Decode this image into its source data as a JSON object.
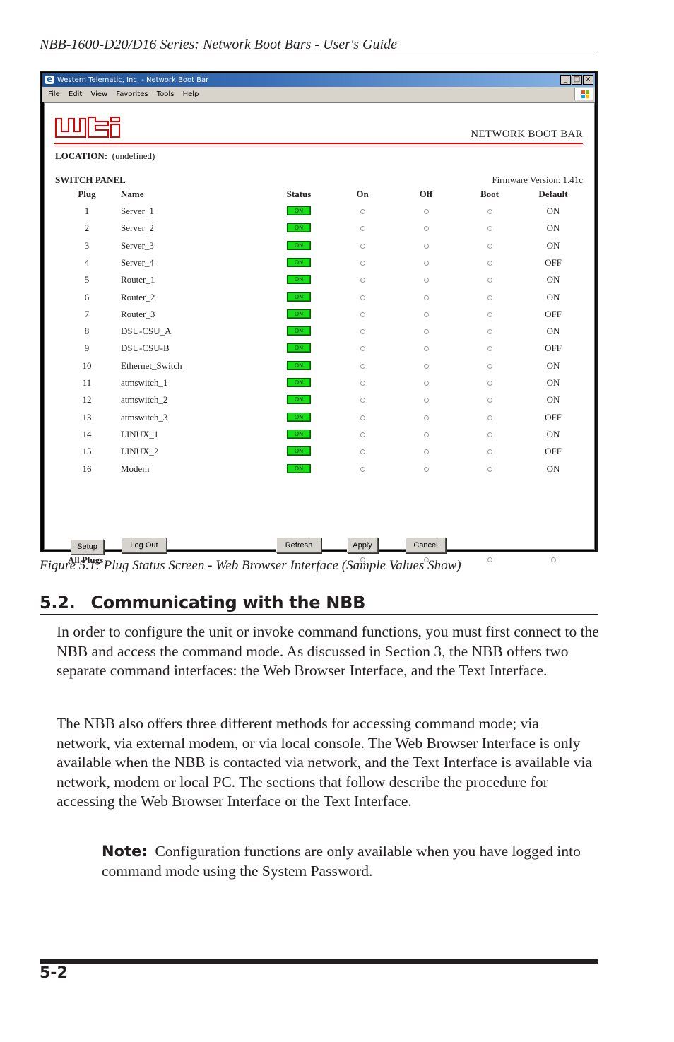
{
  "page": {
    "running_head": "NBB-1600-D20/D16 Series: Network Boot Bars - User's Guide",
    "page_number": "5-2"
  },
  "browser": {
    "title": "Western Telematic, Inc. - Network Boot Bar",
    "window_buttons": [
      "_",
      "□",
      "×"
    ],
    "menu": [
      "File",
      "Edit",
      "View",
      "Favorites",
      "Tools",
      "Help"
    ]
  },
  "nbb": {
    "logo": "wti",
    "product_title": "NETWORK BOOT BAR",
    "location_label": "LOCATION:",
    "location_value": "(undefined)",
    "switch_panel_label": "SWITCH PANEL",
    "firmware": "Firmware Version: 1.41c",
    "headers": {
      "plug": "Plug",
      "name": "Name",
      "status": "Status",
      "on": "On",
      "off": "Off",
      "boot": "Boot",
      "default": "Default"
    },
    "rows": [
      {
        "plug": "1",
        "name": "Server_1",
        "status": "ON",
        "default": "ON"
      },
      {
        "plug": "2",
        "name": "Server_2",
        "status": "ON",
        "default": "ON"
      },
      {
        "plug": "3",
        "name": "Server_3",
        "status": "ON",
        "default": "ON"
      },
      {
        "plug": "4",
        "name": "Server_4",
        "status": "ON",
        "default": "OFF"
      },
      {
        "plug": "5",
        "name": "Router_1",
        "status": "ON",
        "default": "ON"
      },
      {
        "plug": "6",
        "name": "Router_2",
        "status": "ON",
        "default": "ON"
      },
      {
        "plug": "7",
        "name": "Router_3",
        "status": "ON",
        "default": "OFF"
      },
      {
        "plug": "8",
        "name": "DSU-CSU_A",
        "status": "ON",
        "default": "ON"
      },
      {
        "plug": "9",
        "name": "DSU-CSU-B",
        "status": "ON",
        "default": "OFF"
      },
      {
        "plug": "10",
        "name": "Ethernet_Switch",
        "status": "ON",
        "default": "ON"
      },
      {
        "plug": "11",
        "name": "atmswitch_1",
        "status": "ON",
        "default": "ON"
      },
      {
        "plug": "12",
        "name": "atmswitch_2",
        "status": "ON",
        "default": "ON"
      },
      {
        "plug": "13",
        "name": "atmswitch_3",
        "status": "ON",
        "default": "OFF"
      },
      {
        "plug": "14",
        "name": "LINUX_1",
        "status": "ON",
        "default": "ON"
      },
      {
        "plug": "15",
        "name": "LINUX_2",
        "status": "ON",
        "default": "OFF"
      },
      {
        "plug": "16",
        "name": "Modem",
        "status": "ON",
        "default": "ON"
      }
    ],
    "all_plugs_label": "All Plugs",
    "buttons": {
      "setup": "Setup",
      "logout": "Log Out",
      "refresh": "Refresh",
      "apply": "Apply",
      "cancel": "Cancel"
    },
    "colors": {
      "accent_red": "#e00000",
      "status_on_green": "#16e016"
    }
  },
  "caption": "Figure 5.1:  Plug Status Screen - Web Browser Interface (Sample Values Show)",
  "section": {
    "number": "5.2.",
    "title": "Communicating with the NBB",
    "paragraphs": [
      "In order to configure the unit or invoke command functions, you must first connect to the NBB and access the command mode.  As discussed in Section 3, the NBB offers two separate command interfaces: the Web Browser Interface, and the Text Interface.",
      "The NBB also offers three different methods for accessing command mode; via network, via external modem, or via local console.  The Web Browser Interface is only available when the NBB is contacted via network, and the Text Interface is available via network, modem or local PC.  The sections that follow describe the procedure for accessing the Web Browser Interface or the Text Interface."
    ],
    "note_label": "Note:",
    "note_text": "Configuration functions are only available when you have logged into command mode using the System Password."
  }
}
